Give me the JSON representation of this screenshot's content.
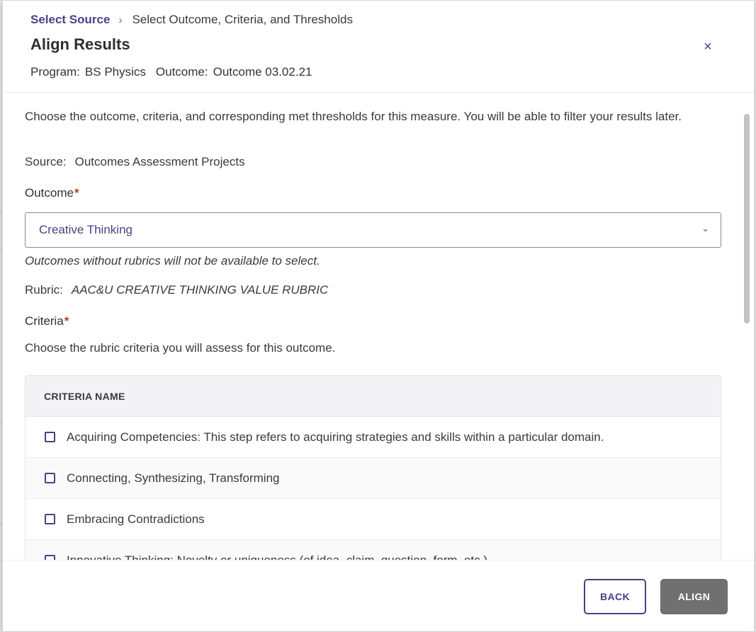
{
  "breadcrumb": {
    "link": "Select Source",
    "separator": "›",
    "current": "Select Outcome, Criteria, and Thresholds"
  },
  "header": {
    "title": "Align Results",
    "close_icon": "×",
    "program_label": "Program:",
    "program_value": "BS Physics",
    "outcome_label": "Outcome:",
    "outcome_value": "Outcome 03.02.21"
  },
  "body": {
    "intro": "Choose the outcome, criteria, and corresponding met thresholds for this measure. You will be able to filter your results later.",
    "source_label": "Source:",
    "source_value": "Outcomes Assessment Projects",
    "outcome_field_label": "Outcome",
    "required_mark": "*",
    "outcome_selected": "Creative Thinking",
    "outcome_chevron": "⌄",
    "outcome_helper": "Outcomes without rubrics will not be available to select.",
    "rubric_label": "Rubric:",
    "rubric_value": "AAC&U CREATIVE THINKING VALUE RUBRIC",
    "criteria_field_label": "Criteria",
    "criteria_help": "Choose the rubric criteria you will assess for this outcome."
  },
  "table": {
    "header": "CRITERIA NAME",
    "rows": [
      "Acquiring Competencies: This step refers to acquiring strategies and skills within a particular domain.",
      "Connecting, Synthesizing, Transforming",
      "Embracing Contradictions",
      "Innovative Thinking: Novelty or uniqueness (of idea, claim, question, form, etc.)"
    ]
  },
  "footer": {
    "back_label": "BACK",
    "align_label": "ALIGN"
  },
  "colors": {
    "accent": "#4b3f87",
    "required": "#c0392b",
    "disabled_button": "#707070"
  }
}
